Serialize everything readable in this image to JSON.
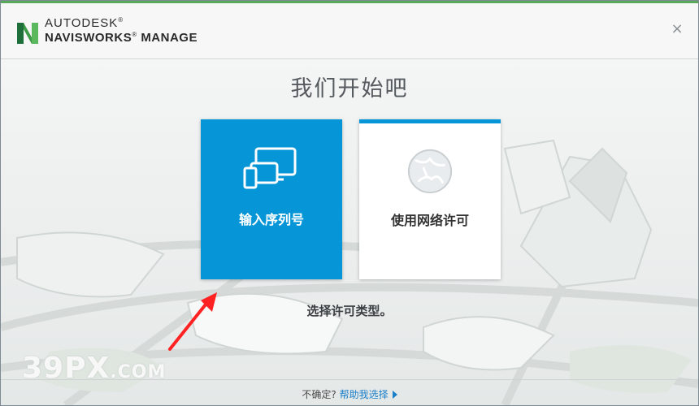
{
  "header": {
    "brand": "AUTODESK",
    "reg_mark": "®",
    "product": "NAVISWORKS",
    "product_suffix": "MANAGE",
    "close_glyph": "×"
  },
  "main": {
    "title": "我们开始吧",
    "cards": [
      {
        "label": "输入序列号",
        "icon": "devices-icon"
      },
      {
        "label": "使用网络许可",
        "icon": "network-globe-icon"
      }
    ],
    "subtitle": "选择许可类型。"
  },
  "footer": {
    "prompt": "不确定?",
    "link": "帮助我选择"
  },
  "watermark": {
    "text": "39PX",
    "suffix": ".COM"
  },
  "colors": {
    "accent_blue": "#0696d7",
    "brand_green": "#3d9b47",
    "annotation_red": "#ff2222"
  }
}
